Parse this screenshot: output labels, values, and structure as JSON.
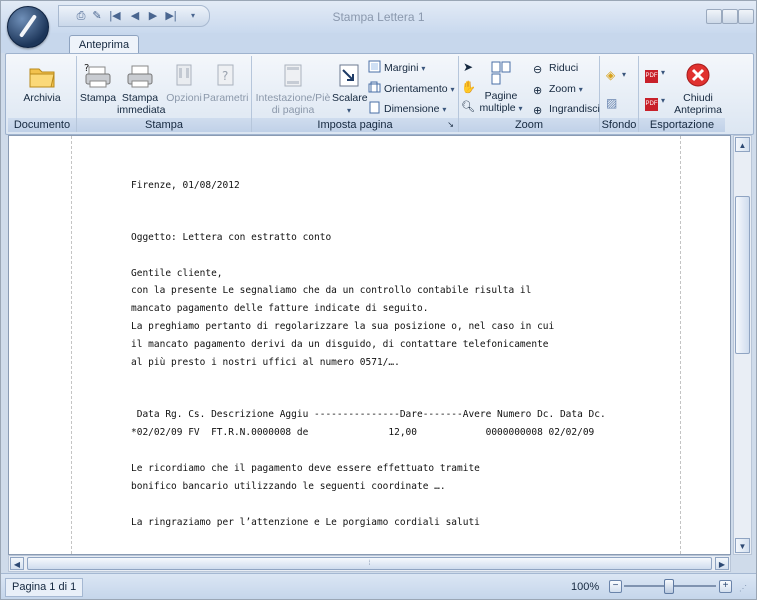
{
  "window": {
    "title": "Stampa Lettera 1",
    "qat_icons": [
      "save-icon",
      "print-icon",
      "first-page-icon",
      "previous-page-icon",
      "next-page-icon",
      "last-page-icon",
      "customize-icon"
    ]
  },
  "tabs": [
    {
      "label": "Anteprima"
    }
  ],
  "ribbon": {
    "groups": {
      "documento": "Documento",
      "stampa": "Stampa",
      "imposta_pagina": "Imposta pagina",
      "zoom": "Zoom",
      "sfondo": "Sfondo",
      "esportazione": "Esportazione"
    },
    "buttons": {
      "archivia": "Archivia",
      "stampa": "Stampa",
      "stampa_immediata_1": "Stampa",
      "stampa_immediata_2": "immediata",
      "opzioni": "Opzioni",
      "parametri": "Parametri",
      "intestazione_1": "Intestazione/Piè",
      "intestazione_2": "di pagina",
      "scalare": "Scalare",
      "margini": "Margini",
      "orientamento": "Orientamento",
      "dimensione": "Dimensione",
      "pagine_multiple_1": "Pagine",
      "pagine_multiple_2": "multiple",
      "riduci": "Riduci",
      "zoom": "Zoom",
      "ingrandisci": "Ingrandisci",
      "chiudi_1": "Chiudi",
      "chiudi_2": "Anteprima"
    }
  },
  "document": {
    "lines": [
      "Firenze, 01/08/2012",
      "Oggetto: Lettera con estratto conto",
      "Gentile cliente,",
      "con la presente Le segnaliamo che da un controllo contabile risulta il",
      "mancato pagamento delle fatture indicate di seguito.",
      "La preghiamo pertanto di regolarizzare la sua posizione o, nel caso in cui",
      "il mancato pagamento derivi da un disguido, di contattare telefonicamente",
      "al più presto i nostri uffici al numero 0571/….",
      " Data Rg. Cs. Descrizione Aggiu ---------------Dare-------Avere Numero Dc. Data Dc.",
      "*02/02/09 FV  FT.R.N.0000008 de              12,00            0000000008 02/02/09",
      "Le ricordiamo che il pagamento deve essere effettuato tramite",
      "bonifico bancario utilizzando le seguenti coordinate ….",
      "La ringraziamo per l’attenzione e Le porgiamo cordiali saluti"
    ]
  },
  "status": {
    "page": "Pagina 1 di 1",
    "zoom": "100%",
    "zoom_level_percent": 100
  }
}
